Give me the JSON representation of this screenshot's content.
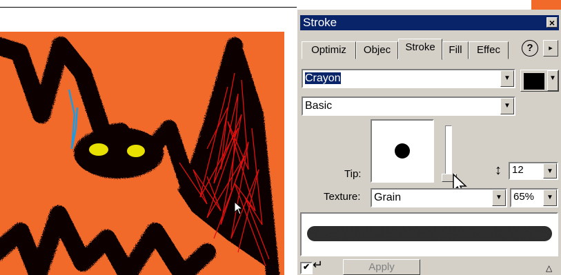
{
  "panel": {
    "title": "Stroke",
    "close_glyph": "×",
    "tabs": [
      "Optimiz",
      "Objec",
      "Stroke",
      "Fill",
      "Effec"
    ],
    "active_tab": "Stroke",
    "help_glyph": "?",
    "menu_arrow_glyph": "▸",
    "stroke_category": "Crayon",
    "stroke_type": "Basic",
    "stroke_color": "#000000",
    "tip_label": "Tip:",
    "tip_size": "12",
    "texture_label": "Texture:",
    "texture": "Grain",
    "texture_amount": "65%",
    "apply_label": "Apply",
    "dropdown_arrow": "▼",
    "resize_glyph": "↕",
    "enter_glyph": "↵",
    "check_glyph": "✔",
    "collapse_glyph": "△"
  },
  "colors": {
    "canvas_bg": "#f26a2a",
    "title_bar": "#0a246a",
    "panel_bg": "#d4d0c8",
    "accent_red": "#e01010",
    "accent_blue": "#1e9be0",
    "eye_yellow": "#e8e000"
  }
}
